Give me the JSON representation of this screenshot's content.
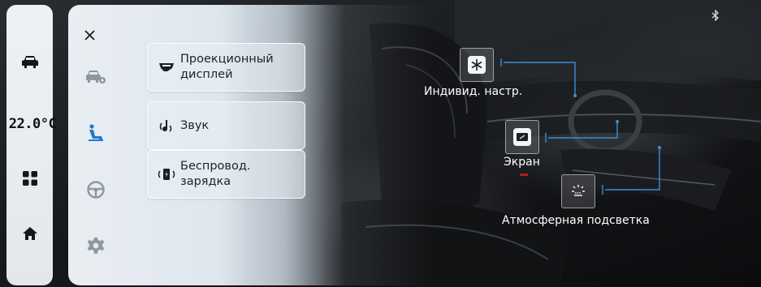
{
  "climate": {
    "temperature": "22.0°C"
  },
  "rail": {
    "buttons": [
      {
        "icon": "car-icon"
      },
      {
        "icon": "apps-grid-icon"
      },
      {
        "icon": "home-icon"
      }
    ]
  },
  "panel": {
    "close_icon": "close-icon",
    "side_tabs": [
      {
        "icon": "car-settings-icon",
        "active": false
      },
      {
        "icon": "seat-icon",
        "active": true
      },
      {
        "icon": "steering-wheel-icon",
        "active": false
      },
      {
        "icon": "gear-icon",
        "active": false
      }
    ],
    "cards": [
      {
        "icon": "hud-icon",
        "label": "Проекционный дисплей"
      },
      {
        "icon": "sound-icon",
        "label": "Звук"
      },
      {
        "icon": "wireless-charging-icon",
        "label": "Беспровод. зарядка"
      }
    ]
  },
  "hotspots": [
    {
      "icon": "snowflake-icon",
      "label": "Индивид. настр."
    },
    {
      "icon": "screen-icon",
      "label": "Экран"
    },
    {
      "icon": "ambient-light-icon",
      "label": "Атмосферная подсветка"
    }
  ],
  "status": {
    "bluetooth_icon": "bluetooth-icon"
  },
  "colors": {
    "accent": "#1f78c8",
    "panel_bg": "#e6ecf2",
    "text": "#1e2328",
    "leader_line": "#3a8ed8"
  }
}
